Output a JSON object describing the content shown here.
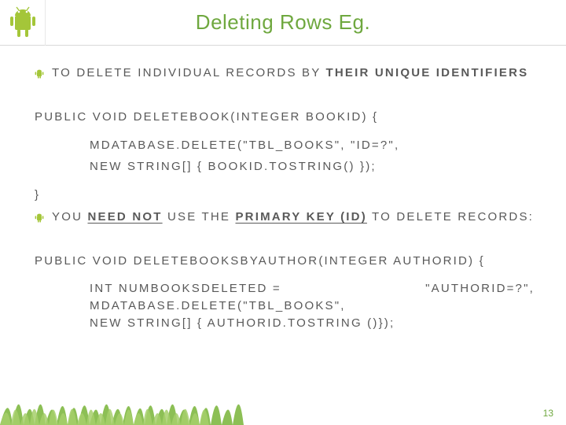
{
  "header": {
    "title": "Deleting Rows Eg."
  },
  "bullets": {
    "b1_pre": "TO DELETE INDIVIDUAL RECORDS BY ",
    "b1_emph": "THEIR UNIQUE IDENTIFIERS",
    "b2_pre": "YOU ",
    "b2_emph1": "NEED NOT",
    "b2_mid": " USE THE ",
    "b2_emph2": "PRIMARY KEY (ID)",
    "b2_post": " TO DELETE RECORDS:"
  },
  "code": {
    "c1": "PUBLIC VOID DELETEBOOK(INTEGER BOOKID) {",
    "c2": "MDATABASE.DELETE(\"TBL_BOOKS\", \"ID=?\",",
    "c3": "NEW STRING[] { BOOKID.TOSTRING() });",
    "c4": "}",
    "c5": "PUBLIC VOID DELETEBOOKSBYAUTHOR(INTEGER AUTHORID) {",
    "c6a": "INT NUMBOOKSDELETED = MDATABASE.DELETE(\"TBL_BOOKS\",",
    "c6b": "\"AUTHORID=?\",",
    "c7": "NEW STRING[] { AUTHORID.TOSTRING ()});"
  },
  "page_number": "13",
  "colors": {
    "accent": "#6fa83f"
  }
}
